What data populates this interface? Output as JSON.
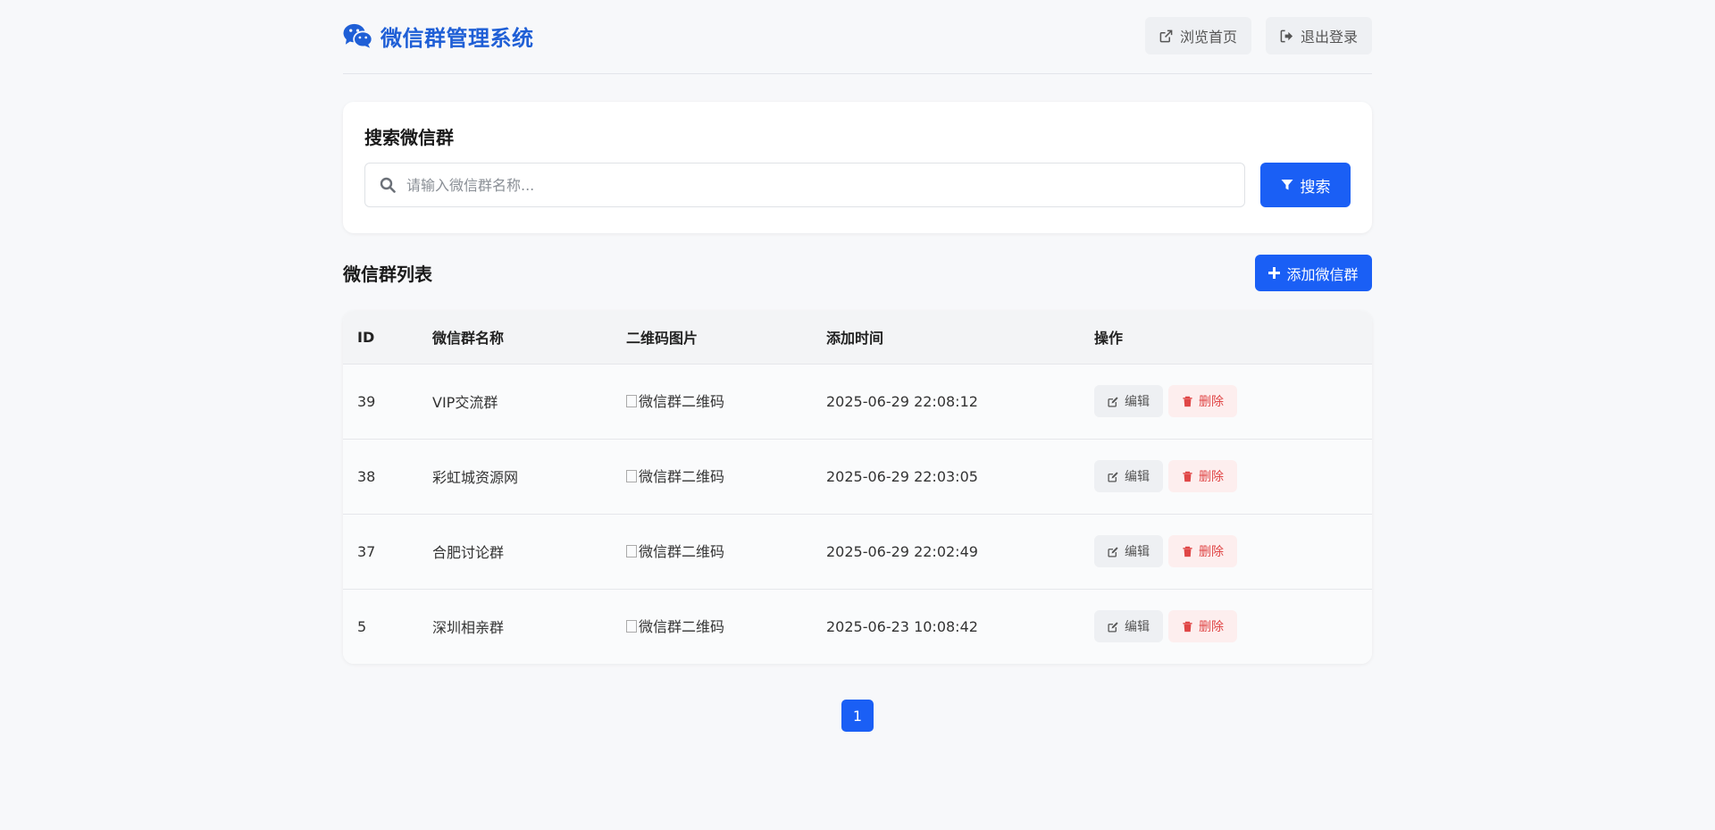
{
  "header": {
    "title": "微信群管理系统",
    "nav": [
      {
        "label": "浏览首页",
        "icon": "external-link-icon"
      },
      {
        "label": "退出登录",
        "icon": "sign-out-icon"
      }
    ]
  },
  "search": {
    "title": "搜索微信群",
    "placeholder": "请输入微信群名称...",
    "value": "",
    "button_label": "搜索"
  },
  "list": {
    "title": "微信群列表",
    "add_label": "添加微信群",
    "columns": [
      "ID",
      "微信群名称",
      "二维码图片",
      "添加时间",
      "操作"
    ],
    "rows": [
      {
        "id": "39",
        "name": "VIP交流群",
        "qr_alt": "微信群二维码",
        "time": "2025-06-29 22:08:12"
      },
      {
        "id": "38",
        "name": "彩虹城资源网",
        "qr_alt": "微信群二维码",
        "time": "2025-06-29 22:03:05"
      },
      {
        "id": "37",
        "name": "合肥讨论群",
        "qr_alt": "微信群二维码",
        "time": "2025-06-29 22:02:49"
      },
      {
        "id": "5",
        "name": "深圳相亲群",
        "qr_alt": "微信群二维码",
        "time": "2025-06-23 10:08:42"
      }
    ],
    "edit_label": "编辑",
    "delete_label": "删除"
  },
  "pagination": {
    "pages": [
      "1"
    ],
    "current": "1"
  },
  "colors": {
    "accent": "#1a5ff5",
    "brand": "#1f5fd6",
    "danger": "#e04646"
  }
}
